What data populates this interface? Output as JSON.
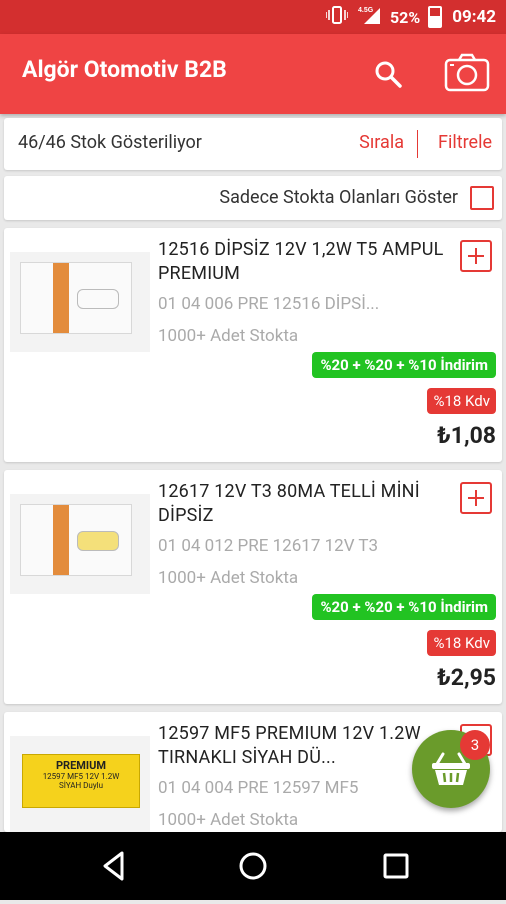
{
  "status_bar": {
    "network": "4.5G",
    "battery": "52%",
    "time": "09:42"
  },
  "app_bar": {
    "title": "Algör Otomotiv B2B"
  },
  "list_header": {
    "count_text": "46/46 Stok Gösteriliyor",
    "sort_label": "Sırala",
    "filter_label": "Filtrele"
  },
  "stock_filter": {
    "label": "Sadece Stokta Olanları Göster",
    "checked": false
  },
  "products": [
    {
      "name": "12516 DİPSİZ 12V 1,2W T5 AMPUL PREMIUM",
      "code": "01 04 006 PRE 12516 DİPSİ...",
      "stock": "1000+ Adet Stokta",
      "discount": "%20 + %20 + %10 İndirim",
      "vat": "%18 Kdv",
      "price": "₺1,08"
    },
    {
      "name": "12617 12V T3 80MA TELLİ MİNİ DİPSİZ",
      "code": "01 04 012 PRE 12617 12V T3",
      "stock": "1000+ Adet Stokta",
      "discount": "%20 + %20 + %10 İndirim",
      "vat": "%18 Kdv",
      "price": "₺2,95"
    },
    {
      "name": "12597 MF5 PREMIUM 12V 1.2W TIRNAKLI SİYAH DÜ...",
      "code": "01 04 004 PRE 12597 MF5",
      "stock": "1000+ Adet Stokta",
      "image_text_title": "PREMIUM",
      "image_text_line1": "12597 MF5 12V 1.2W",
      "image_text_line2": "SİYAH Duylu"
    }
  ],
  "cart": {
    "badge_count": "3"
  },
  "colors": {
    "primary": "#ef4444",
    "status_bar": "#d32f2f",
    "discount": "#22c322",
    "cart_fab": "#6a9b2b"
  }
}
